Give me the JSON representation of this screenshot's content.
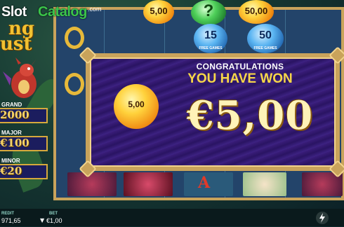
{
  "watermark": {
    "part1": "Slot",
    "part2": "Catalog",
    "suffix": ".com"
  },
  "game_title": {
    "line1": "ng",
    "line2": "ust"
  },
  "jackpots": [
    {
      "label": "GRAND",
      "value": "2000"
    },
    {
      "label": "MAJOR",
      "value": "€100"
    },
    {
      "label": "MINOR",
      "value": "€20"
    }
  ],
  "orbs_top": [
    {
      "text": "5,00",
      "kind": "yellow"
    },
    {
      "text": "?",
      "kind": "green"
    },
    {
      "text": "50,00",
      "kind": "yellow"
    }
  ],
  "orbs_free_games": [
    {
      "number": "15",
      "caption": "FREE GAMES"
    },
    {
      "number": "50",
      "caption": "FREE GAMES"
    }
  ],
  "popup": {
    "congrats": "CONGRATULATIONS",
    "won_line": "YOU HAVE WON",
    "amount": "€5,00",
    "orb_value": "5,00"
  },
  "bottom_bar": {
    "credit_label": "REDIT",
    "credit_value": "971,65",
    "bet_label": "BET",
    "bet_value": "€1,00"
  },
  "colors": {
    "gold": "#c9a35b",
    "popup_purple": "#2a1463",
    "jackpot_box": "#1b1d5e"
  }
}
